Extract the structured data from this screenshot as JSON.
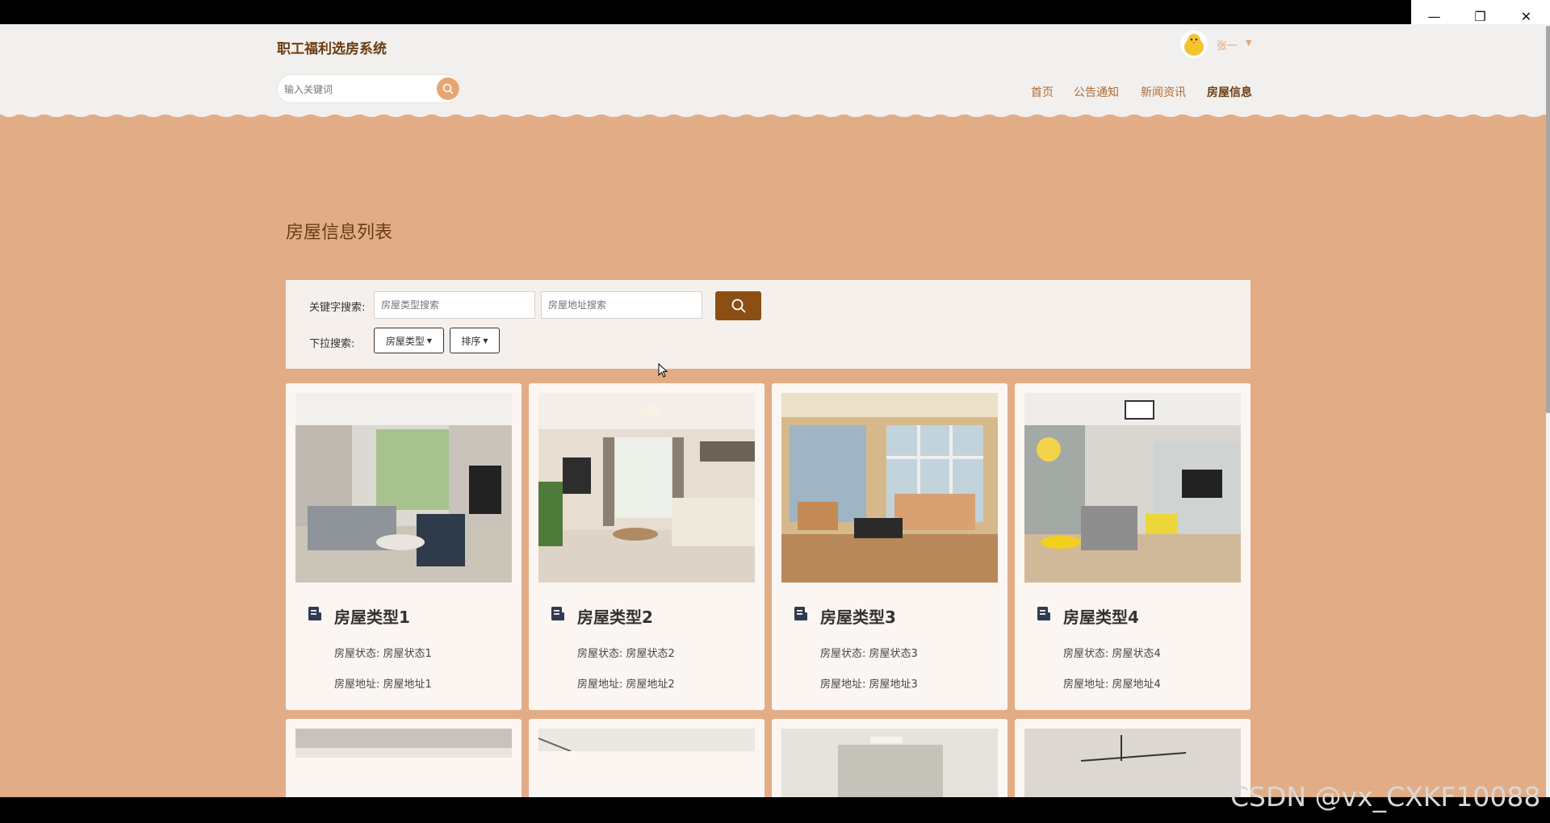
{
  "window": {
    "minimize_icon": "minimize-icon",
    "restore_icon": "restore-icon",
    "close_icon": "close-icon"
  },
  "header": {
    "site_title": "职工福利选房系统",
    "search_placeholder": "输入关键词",
    "user_name": "张一",
    "nav": [
      {
        "label": "首页",
        "active": false
      },
      {
        "label": "公告通知",
        "active": false
      },
      {
        "label": "新闻资讯",
        "active": false
      },
      {
        "label": "房屋信息",
        "active": true
      }
    ]
  },
  "main": {
    "heading": "房屋信息列表",
    "filter": {
      "keyword_label": "关键字搜索:",
      "type_placeholder": "房屋类型搜索",
      "address_placeholder": "房屋地址搜索",
      "dropdown_label": "下拉搜索:",
      "dropdown_type": "房屋类型",
      "dropdown_sort": "排序"
    },
    "cards": [
      {
        "title": "房屋类型1",
        "status": "房屋状态: 房屋状态1",
        "address": "房屋地址: 房屋地址1"
      },
      {
        "title": "房屋类型2",
        "status": "房屋状态: 房屋状态2",
        "address": "房屋地址: 房屋地址2"
      },
      {
        "title": "房屋类型3",
        "status": "房屋状态: 房屋状态3",
        "address": "房屋地址: 房屋地址3"
      },
      {
        "title": "房屋类型4",
        "status": "房屋状态: 房屋状态4",
        "address": "房屋地址: 房屋地址4"
      }
    ]
  },
  "watermark": "CSDN @vx_CXKF10088",
  "colors": {
    "background": "#e2ad86",
    "accent_dark": "#8b4f14",
    "accent_light": "#e6a674",
    "header_bg": "#f2f0ef"
  }
}
